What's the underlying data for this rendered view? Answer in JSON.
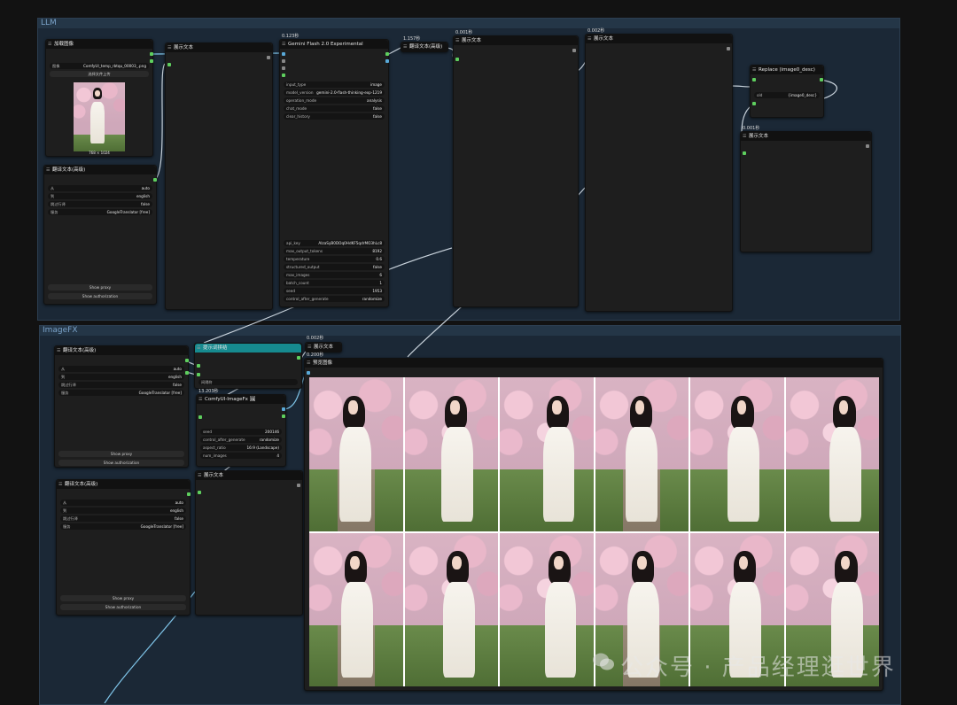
{
  "groups": {
    "llm": "LLM",
    "imagefx": "ImageFX"
  },
  "load_image": {
    "title": "加载图像",
    "image_label": "图像",
    "image_value": "ComfyUI_temp_rbtqu_00003_.png",
    "upload_label": "选择文件上传",
    "dims": "768 × 1024"
  },
  "translate1": {
    "title": "翻译文本(高级)",
    "rows": [
      {
        "k": "从",
        "v": "auto"
      },
      {
        "k": "到",
        "v": "english"
      },
      {
        "k": "跳过行译",
        "v": "false"
      },
      {
        "k": "服务",
        "v": "GoogleTranslator [free]"
      }
    ],
    "show_proxy": "Show proxy",
    "show_auth": "Show authorization"
  },
  "show_text_a": {
    "title": "展示文本"
  },
  "gemini": {
    "time": "0.123秒",
    "title": "Gemini Flash 2.0 Experimental",
    "rows": [
      {
        "k": "input_type",
        "v": "image"
      },
      {
        "k": "model_version",
        "v": "gemini-2.0-flash-thinking-exp-1219"
      },
      {
        "k": "operation_mode",
        "v": "analysis"
      },
      {
        "k": "chat_mode",
        "v": "false"
      },
      {
        "k": "clear_history",
        "v": "false"
      }
    ],
    "rows2": [
      {
        "k": "api_key",
        "v": "AIzaSyB0DOq0HdKF5qdrMO3hLc8"
      },
      {
        "k": "max_output_tokens",
        "v": "8192"
      },
      {
        "k": "temperature",
        "v": "0.6"
      },
      {
        "k": "structured_output",
        "v": "false"
      },
      {
        "k": "max_images",
        "v": "6"
      },
      {
        "k": "batch_count",
        "v": "1"
      },
      {
        "k": "seed",
        "v": "1953"
      },
      {
        "k": "control_after_generate",
        "v": "randomize"
      }
    ]
  },
  "translate_mid": {
    "time": "1.157秒",
    "title": "翻译文本(高级)"
  },
  "show_text_b": {
    "time": "0.001秒",
    "title": "展示文本"
  },
  "show_text_c": {
    "time": "0.002秒",
    "title": "展示文本"
  },
  "replace": {
    "title": "Replace (image0_desc)",
    "k": "old",
    "v": "{image0_desc}"
  },
  "show_text_d": {
    "time": "0.001秒",
    "title": "展示文本"
  },
  "translate2": {
    "title": "翻译文本(高级)",
    "rows": [
      {
        "k": "从",
        "v": "auto"
      },
      {
        "k": "到",
        "v": "english"
      },
      {
        "k": "跳过行译",
        "v": "false"
      },
      {
        "k": "服务",
        "v": "GoogleTranslator [free]"
      }
    ],
    "show_proxy": "Show proxy",
    "show_auth": "Show authorization"
  },
  "prompt_combiner": {
    "title": "提示词拼结",
    "sep_label": "间隔符"
  },
  "imagefx": {
    "time": "13.203秒",
    "title": "ComfyUI-ImageFx 🖼",
    "rows": [
      {
        "k": "seed",
        "v": "200146"
      },
      {
        "k": "control_after_generate",
        "v": "randomize"
      },
      {
        "k": "aspect_ratio",
        "v": "16:9 (Landscape)"
      },
      {
        "k": "num_images",
        "v": "4"
      }
    ]
  },
  "show_text_e": {
    "title": "展示文本"
  },
  "translate3": {
    "title": "翻译文本(高级)",
    "rows": [
      {
        "k": "从",
        "v": "auto"
      },
      {
        "k": "到",
        "v": "english"
      },
      {
        "k": "跳过行译",
        "v": "false"
      },
      {
        "k": "服务",
        "v": "GoogleTranslator [free]"
      }
    ],
    "show_proxy": "Show proxy",
    "show_auth": "Show authorization"
  },
  "show_text_f": {
    "time1": "0.002秒",
    "title": "展示文本",
    "time2": "0.200秒"
  },
  "preview": {
    "title": "预览图像"
  },
  "watermark": "公众号 · 产品经理逛世界",
  "colors": {
    "link_blue": "#7fc4e8",
    "link_gray": "#c9d3dc",
    "port_green": "#5ecf5e",
    "teal_header": "#168a8f"
  }
}
